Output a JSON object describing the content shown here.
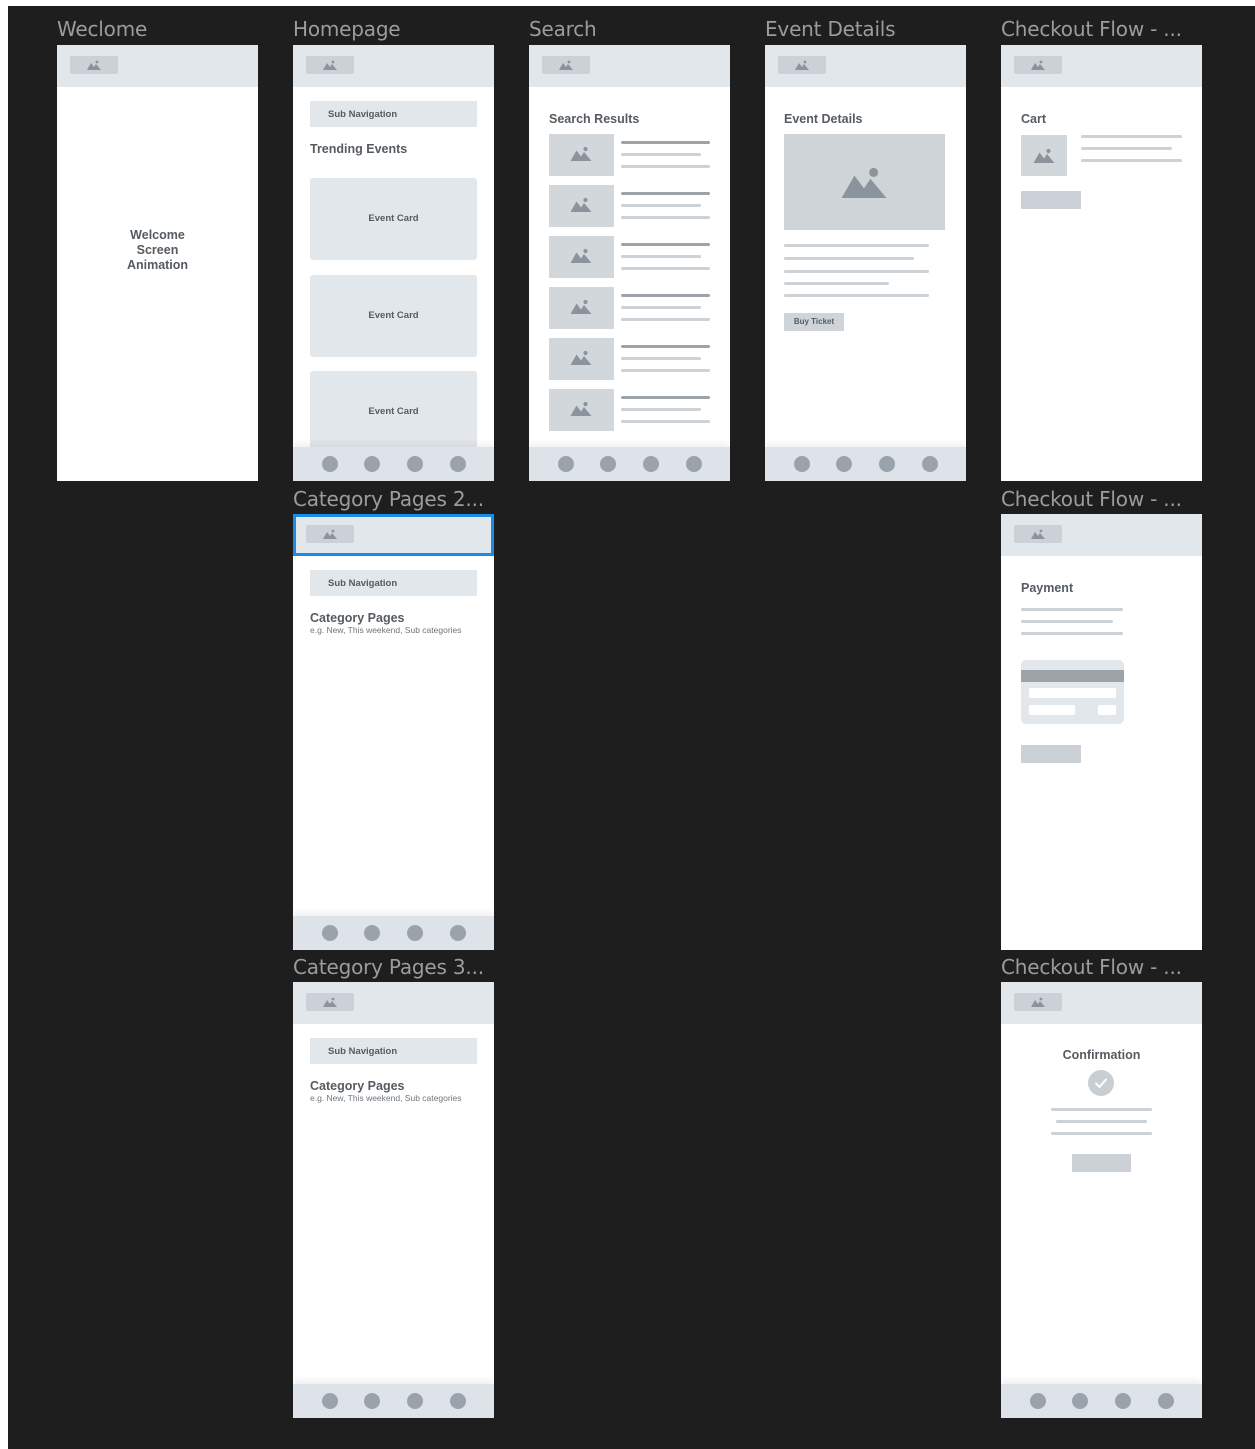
{
  "canvas": {
    "background": "#1e1e1e",
    "selection_color": "#1b8be8"
  },
  "frames": {
    "welcome": {
      "title": "Weclome",
      "text": [
        "Welcome",
        "Screen",
        "Animation"
      ]
    },
    "homepage": {
      "title": "Homepage",
      "sub_navigation": "Sub Navigation",
      "heading": "Trending Events",
      "cards": [
        "Event Card",
        "Event Card",
        "Event Card"
      ]
    },
    "search": {
      "title": "Search",
      "heading": "Search Results"
    },
    "event_details": {
      "title": "Event Details",
      "heading": "Event Details",
      "button": "Buy Ticket"
    },
    "checkout_cart": {
      "title": "Checkout Flow - ...",
      "heading": "Cart"
    },
    "category_2": {
      "title": "Category Pages 2...",
      "sub_navigation": "Sub Navigation",
      "heading": "Category Pages",
      "subheading": "e.g. New, This weekend, Sub categories"
    },
    "checkout_payment": {
      "title": "Checkout Flow - ...",
      "heading": "Payment"
    },
    "category_3": {
      "title": "Category Pages 3...",
      "sub_navigation": "Sub Navigation",
      "heading": "Category Pages",
      "subheading": "e.g. New, This weekend, Sub categories"
    },
    "checkout_confirmation": {
      "title": "Checkout Flow - ...",
      "heading": "Confirmation"
    }
  },
  "icons": {
    "header_logo": "image-placeholder-icon",
    "thumbnail": "image-placeholder-icon",
    "confirmation": "check-circle-icon",
    "tab_bar_item": "circle-nav-icon"
  }
}
